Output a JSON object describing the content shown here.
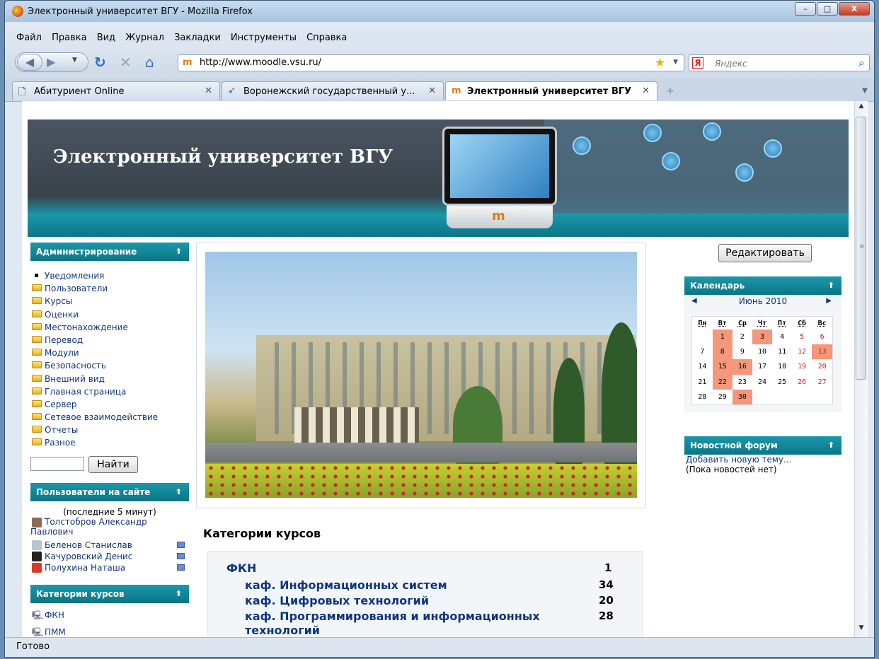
{
  "window": {
    "title": "Электронный университет ВГУ - Mozilla Firefox",
    "controls": {
      "minimize": "–",
      "maximize": "□",
      "close": "X"
    }
  },
  "menu": [
    "Файл",
    "Правка",
    "Вид",
    "Журнал",
    "Закладки",
    "Инструменты",
    "Справка"
  ],
  "nav": {
    "url": "http://www.moodle.vsu.ru/",
    "search_placeholder": "Яндекс",
    "search_engine_letter": "Я"
  },
  "tabs": [
    {
      "label": "Абитуриент Online"
    },
    {
      "label": "Воронежский государственный у..."
    },
    {
      "label": "Электронный университет ВГУ",
      "active": true
    }
  ],
  "status": "Готово",
  "page": {
    "banner_title": "Электронный университет ВГУ",
    "admin": {
      "title": "Администрирование",
      "items": [
        "Уведомления",
        "Пользователи",
        "Курсы",
        "Оценки",
        "Местонахождение",
        "Перевод",
        "Модули",
        "Безопасность",
        "Внешний вид",
        "Главная страница",
        "Сервер",
        "Сетевое взаимодействие",
        "Отчеты",
        "Разное"
      ],
      "search_button": "Найти"
    },
    "online_users": {
      "title": "Пользователи на сайте",
      "subtitle": "(последние 5 минут)",
      "users": [
        "Толстобров Александр Павлович",
        "Беленов Станислав",
        "Качуровский Денис",
        "Полухина Наташа"
      ]
    },
    "course_categories_block": {
      "title": "Категории курсов",
      "items": [
        "ФКН",
        "ПММ"
      ]
    },
    "categories_heading": "Категории курсов",
    "categories": [
      {
        "name": "ФКН",
        "count": "1"
      },
      {
        "name": "каф. Информационных систем",
        "count": "34"
      },
      {
        "name": "каф. Цифровых технологий",
        "count": "20"
      },
      {
        "name": "каф. Программирования и информационных технологий",
        "count": "28"
      }
    ],
    "edit_button": "Редактировать",
    "calendar": {
      "title": "Календарь",
      "month": "Июнь 2010",
      "weekdays": [
        "Пн",
        "Вт",
        "Ср",
        "Чт",
        "Пт",
        "Сб",
        "Вс"
      ],
      "weeks": [
        [
          "",
          "1",
          "2",
          "3",
          "4",
          "5",
          "6"
        ],
        [
          "7",
          "8",
          "9",
          "10",
          "11",
          "12",
          "13"
        ],
        [
          "14",
          "15",
          "16",
          "17",
          "18",
          "19",
          "20"
        ],
        [
          "21",
          "22",
          "23",
          "24",
          "25",
          "26",
          "27"
        ],
        [
          "28",
          "29",
          "30",
          "",
          "",
          "",
          ""
        ]
      ],
      "event_days": [
        "1",
        "3",
        "8",
        "13",
        "15",
        "16",
        "22",
        "30"
      ]
    },
    "news": {
      "title": "Новостной форум",
      "add_link": "Добавить новую тему...",
      "empty": "(Пока новостей нет)"
    }
  }
}
